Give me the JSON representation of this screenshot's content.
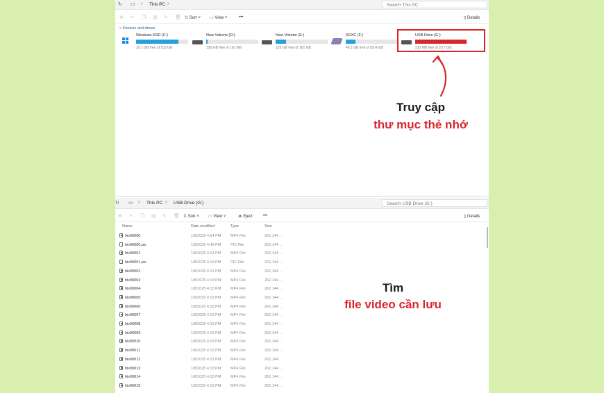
{
  "top_window": {
    "address": {
      "crumb": "This PC",
      "search_placeholder": "Search This PC"
    },
    "toolbar": {
      "sort": "Sort",
      "view": "View",
      "more": "•••",
      "details": "Details"
    },
    "section_label": "Devices and drives",
    "drives": [
      {
        "name": "Windows-SSD (C:)",
        "free": "29.1 GB free of 153 GB",
        "used_fraction": 0.81,
        "icon": "windows-drive-icon"
      },
      {
        "name": "New Volume (D:)",
        "free": "156 GB free of 161 GB",
        "used_fraction": 0.03,
        "icon": "hard-drive-icon"
      },
      {
        "name": "New Volume (E:)",
        "free": "129 GB free of 161 GB",
        "used_fraction": 0.2,
        "icon": "hard-drive-icon"
      },
      {
        "name": "SDXC (F:)",
        "free": "48.1 GB free of 59.4 GB",
        "used_fraction": 0.19,
        "icon": "sd-card-icon"
      },
      {
        "name": "USB Drive (G:)",
        "free": "310 MB free of 29.7 GB",
        "used_fraction": 0.99,
        "icon": "usb-drive-icon",
        "bar_color": "#d9262c"
      }
    ]
  },
  "annotation_top": {
    "line1": "Truy cập",
    "line2": "thư mục thẻ nhớ"
  },
  "bottom_window": {
    "address": {
      "crumb1": "This PC",
      "crumb2": "USB Drive (G:)",
      "search_placeholder": "Search USB Drive (G:)"
    },
    "toolbar": {
      "sort": "Sort",
      "view": "View",
      "eject": "Eject",
      "more": "•••",
      "details": "Details"
    },
    "columns": {
      "name": "Name",
      "date": "Date modified",
      "type": "Type",
      "size": "Size"
    },
    "files": [
      {
        "name": "hiv00000",
        "date": "1/8/2025 4:54 PM",
        "type": "MP4 File",
        "size": "262,144 ...",
        "kind": "mp4"
      },
      {
        "name": "hiv00000.pic",
        "date": "1/8/2025 4:49 PM",
        "type": "PIC File",
        "size": "262,144 ...",
        "kind": "pic"
      },
      {
        "name": "hiv00001",
        "date": "1/8/2025 4:13 PM",
        "type": "MP4 File",
        "size": "262,144 ...",
        "kind": "mp4"
      },
      {
        "name": "hiv00001.pic",
        "date": "1/8/2025 4:13 PM",
        "type": "PIC File",
        "size": "262,144 ...",
        "kind": "pic"
      },
      {
        "name": "hiv00002",
        "date": "1/8/2025 4:13 PM",
        "type": "MP4 File",
        "size": "262,144 ...",
        "kind": "mp4"
      },
      {
        "name": "hiv00003",
        "date": "1/8/2025 4:13 PM",
        "type": "MP4 File",
        "size": "262,144 ...",
        "kind": "mp4"
      },
      {
        "name": "hiv00004",
        "date": "1/8/2025 4:13 PM",
        "type": "MP4 File",
        "size": "262,144 ...",
        "kind": "mp4"
      },
      {
        "name": "hiv00005",
        "date": "1/8/2025 4:13 PM",
        "type": "MP4 File",
        "size": "262,144 ...",
        "kind": "mp4"
      },
      {
        "name": "hiv00006",
        "date": "1/8/2025 4:13 PM",
        "type": "MP4 File",
        "size": "262,144 ...",
        "kind": "mp4"
      },
      {
        "name": "hiv00007",
        "date": "1/8/2025 4:13 PM",
        "type": "MP4 File",
        "size": "262,144 ...",
        "kind": "mp4"
      },
      {
        "name": "hiv00008",
        "date": "1/8/2025 4:13 PM",
        "type": "MP4 File",
        "size": "262,144 ...",
        "kind": "mp4"
      },
      {
        "name": "hiv00009",
        "date": "1/8/2025 4:13 PM",
        "type": "MP4 File",
        "size": "262,144 ...",
        "kind": "mp4"
      },
      {
        "name": "hiv00010",
        "date": "1/8/2025 4:13 PM",
        "type": "MP4 File",
        "size": "262,144 ...",
        "kind": "mp4"
      },
      {
        "name": "hiv00011",
        "date": "1/8/2025 4:13 PM",
        "type": "MP4 File",
        "size": "262,144 ...",
        "kind": "mp4"
      },
      {
        "name": "hiv00012",
        "date": "1/8/2025 4:13 PM",
        "type": "MP4 File",
        "size": "262,144 ...",
        "kind": "mp4"
      },
      {
        "name": "hiv00013",
        "date": "1/8/2025 4:13 PM",
        "type": "MP4 File",
        "size": "262,144 ...",
        "kind": "mp4"
      },
      {
        "name": "hiv00014",
        "date": "1/8/2025 4:13 PM",
        "type": "MP4 File",
        "size": "262,144 ...",
        "kind": "mp4"
      },
      {
        "name": "hiv00015",
        "date": "1/8/2025 4:13 PM",
        "type": "MP4 File",
        "size": "262,144 ...",
        "kind": "mp4"
      }
    ]
  },
  "annotation_bottom": {
    "line1": "Tìm",
    "line2": "file video cần lưu"
  },
  "colors": {
    "background": "#d9efaf",
    "accent_red": "#d9262c",
    "drive_bar": "#26a0da"
  }
}
